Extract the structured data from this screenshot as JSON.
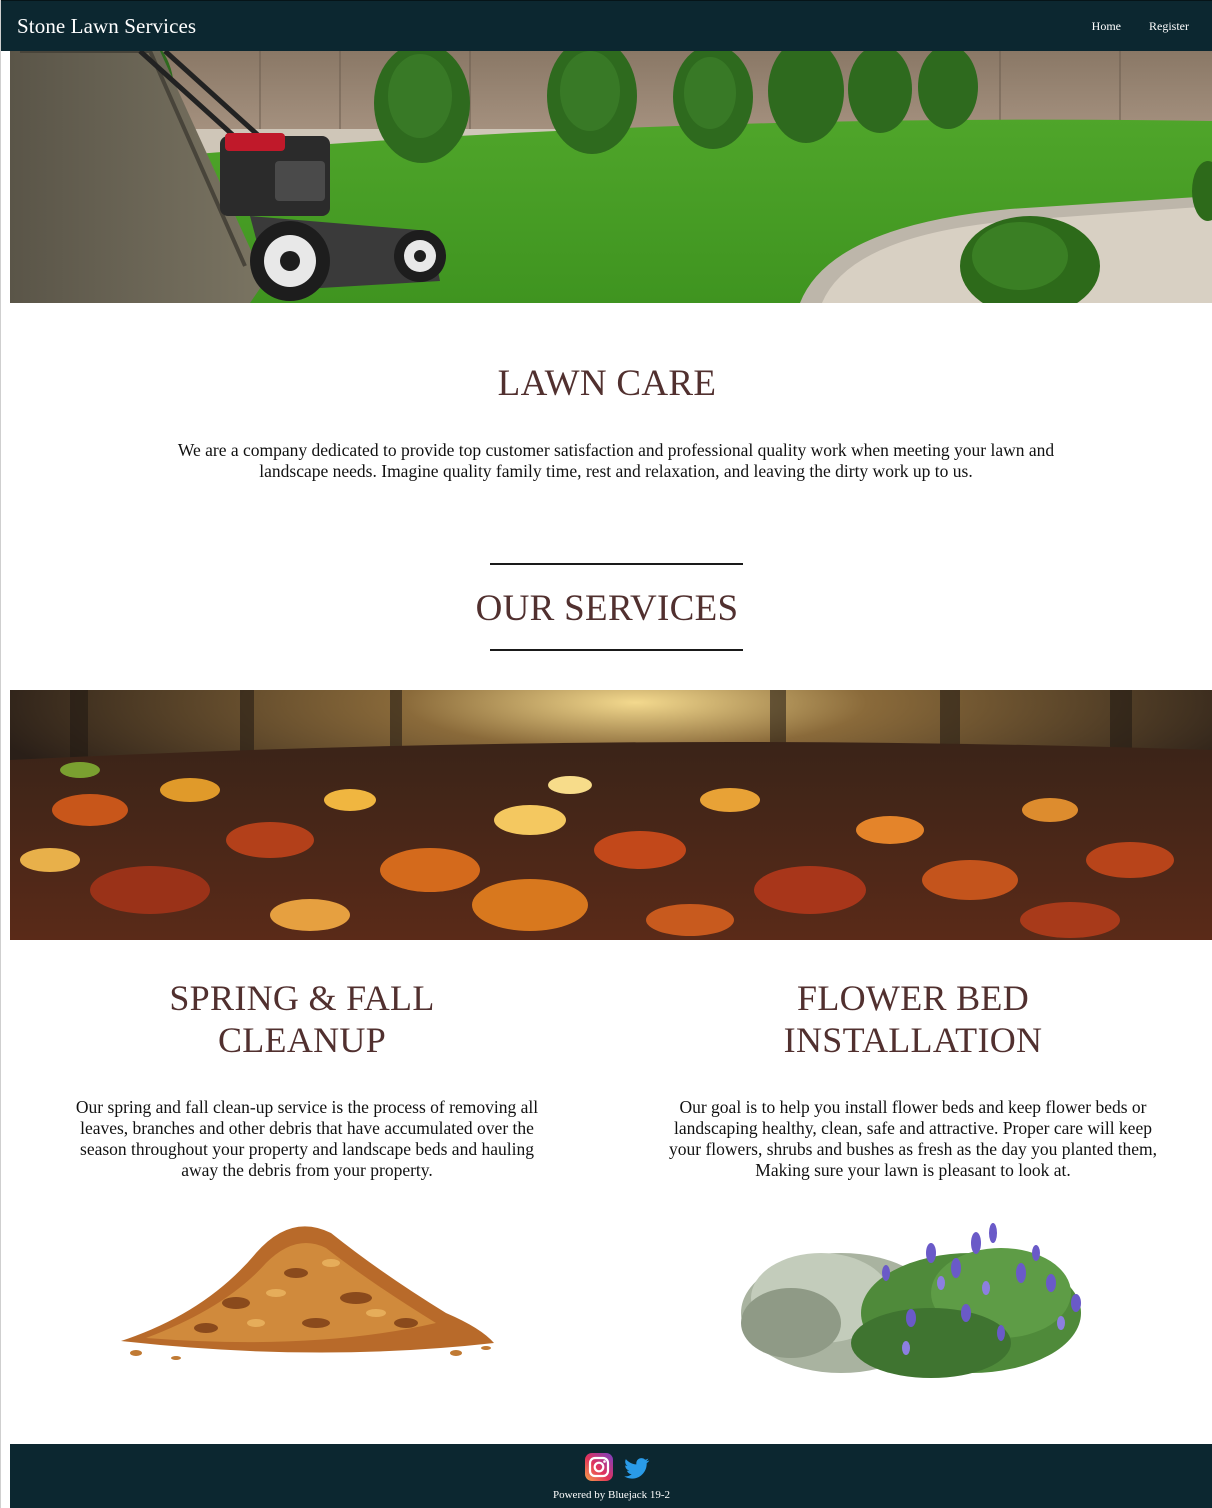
{
  "navbar": {
    "brand": "Stone Lawn Services",
    "links": [
      {
        "label": "Home"
      },
      {
        "label": "Register"
      }
    ]
  },
  "intro": {
    "title": "LAWN CARE",
    "text": "We are a company dedicated to provide top customer satisfaction and professional quality work when meeting your lawn and landscape needs. Imagine quality family time, rest and relaxation, and leaving the dirty work up to us."
  },
  "services": {
    "title": "OUR SERVICES",
    "items": [
      {
        "title_line1": "SPRING & FALL",
        "title_line2": "CLEANUP",
        "text": "Our spring and fall clean-up service is the process of removing all leaves, branches and other debris that have accumulated over the season throughout your property and landscape beds and hauling away the debris from your property."
      },
      {
        "title_line1": "FLOWER BED",
        "title_line2": "INSTALLATION",
        "text": "Our goal is to help you install flower beds and keep flower beds or landscaping healthy, clean, safe and attractive. Proper care will keep your flowers, shrubs and bushes as fresh as the day you planted them, Making sure your lawn is pleasant to look at."
      }
    ]
  },
  "footer": {
    "powered": "Powered by Bluejack 19-2",
    "icons": [
      "instagram-icon",
      "twitter-icon"
    ]
  },
  "colors": {
    "navbar": "#0c2730",
    "heading": "#51302f"
  }
}
